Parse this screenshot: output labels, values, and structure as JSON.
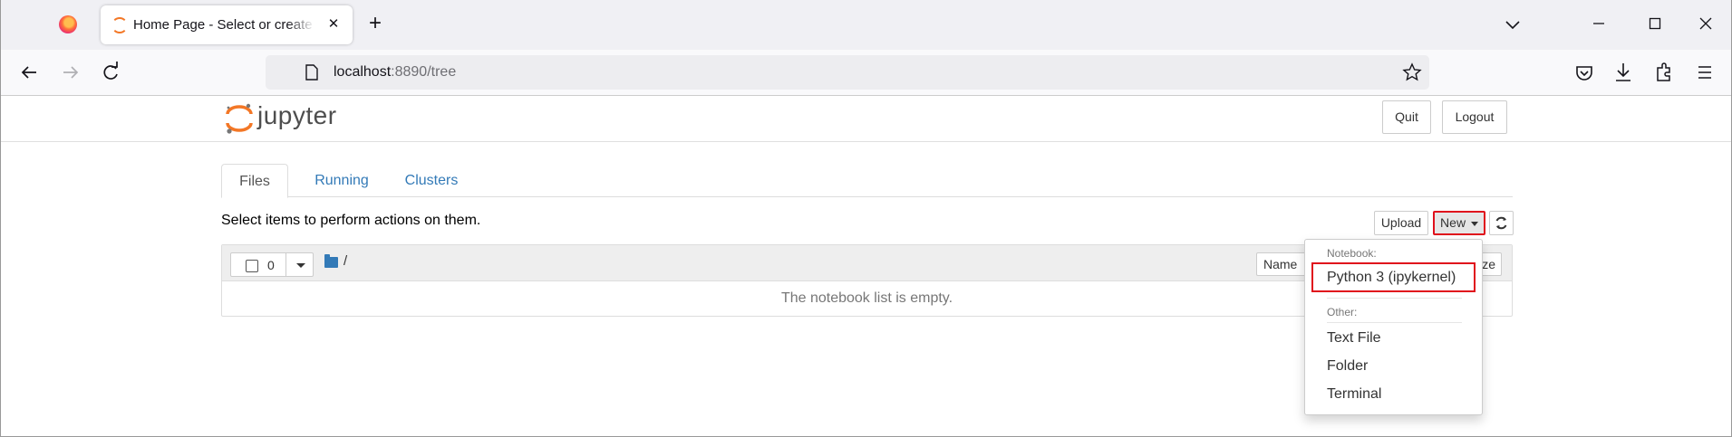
{
  "browser": {
    "tab_title": "Home Page - Select or create a notebook",
    "url_host": "localhost",
    "url_rest": ":8890/tree"
  },
  "header": {
    "logo_text": "jupyter",
    "quit_label": "Quit",
    "logout_label": "Logout"
  },
  "tabs": [
    {
      "label": "Files",
      "active": true
    },
    {
      "label": "Running",
      "active": false
    },
    {
      "label": "Clusters",
      "active": false
    }
  ],
  "toolbar": {
    "hint": "Select items to perform actions on them.",
    "upload_label": "Upload",
    "new_label": "New"
  },
  "file_list": {
    "selected_count": "0",
    "path": "/",
    "name_sort_label": "Name",
    "size_sort_label": "ze",
    "empty_message": "The notebook list is empty."
  },
  "new_menu": {
    "notebook_header": "Notebook:",
    "notebook_items": [
      "Python 3 (ipykernel)"
    ],
    "other_header": "Other:",
    "other_items": [
      "Text File",
      "Folder",
      "Terminal"
    ]
  },
  "colors": {
    "accent_link": "#337ab7",
    "highlight": "#e0101c",
    "jupyter_orange": "#f37726"
  }
}
